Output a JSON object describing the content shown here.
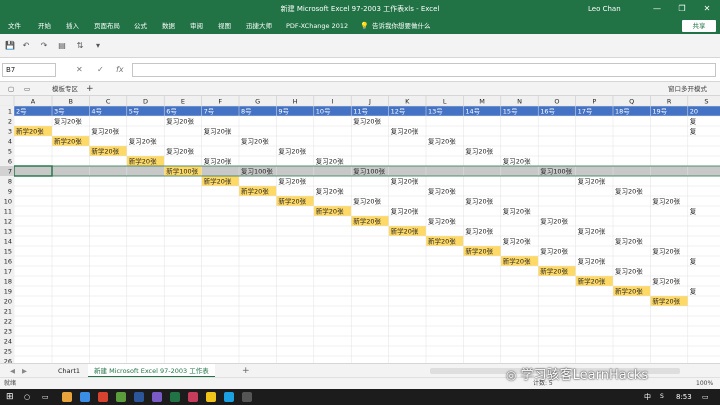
{
  "titlebar": {
    "title": "新建 Microsoft Excel 97-2003 工作表xls  -  Excel",
    "user": "Leo Chan",
    "min_glyph": "—",
    "restore_glyph": "❐",
    "close_glyph": "✕"
  },
  "ribbon": {
    "tabs": [
      "文件",
      "开始",
      "插入",
      "页面布局",
      "公式",
      "数据",
      "审阅",
      "视图",
      "迅捷大师",
      "PDF-XChange 2012"
    ],
    "tell_me": "告诉我你想要做什么",
    "share": "共享"
  },
  "formula_bar": {
    "name_box": "B7",
    "cancel_glyph": "✕",
    "enter_glyph": "✓",
    "fx": "fx",
    "value": ""
  },
  "workbook_strip": {
    "template": "模板专区",
    "add": "+",
    "window_mode": "窗口多开模式"
  },
  "colors": {
    "excel_green": "#217346",
    "day_header": "#4472c4",
    "new_fill": "#ffd966",
    "review_fill": "#ffffff",
    "selected_row": "#c8c8c8"
  },
  "grid": {
    "columns": [
      "A",
      "B",
      "C",
      "D",
      "E",
      "F",
      "G",
      "H",
      "I",
      "J",
      "K",
      "L",
      "M",
      "N",
      "O",
      "P",
      "Q",
      "R",
      "S",
      "T"
    ],
    "row_numbers": [
      "1",
      "2",
      "3",
      "4",
      "5",
      "6",
      "7",
      "8",
      "9",
      "10",
      "11",
      "12",
      "13",
      "14",
      "15",
      "16",
      "17",
      "18",
      "19",
      "20",
      "21",
      "22",
      "23",
      "24",
      "25",
      "26"
    ],
    "days": [
      "2号",
      "3号",
      "4号",
      "5号",
      "6号",
      "7号",
      "8号",
      "9号",
      "10号",
      "11号",
      "12号",
      "13号",
      "14号",
      "15号",
      "16号",
      "17号",
      "18号",
      "19号",
      "20"
    ],
    "cells": [
      {
        "r": 2,
        "c": 1,
        "t": "复习20张",
        "k": "review"
      },
      {
        "r": 2,
        "c": 4,
        "t": "复习20张",
        "k": "review"
      },
      {
        "r": 2,
        "c": 9,
        "t": "复习20张",
        "k": "review"
      },
      {
        "r": 2,
        "c": 18,
        "t": "复",
        "k": "review"
      },
      {
        "r": 3,
        "c": 0,
        "t": "新学20张",
        "k": "new"
      },
      {
        "r": 3,
        "c": 2,
        "t": "复习20张",
        "k": "review"
      },
      {
        "r": 3,
        "c": 5,
        "t": "复习20张",
        "k": "review"
      },
      {
        "r": 3,
        "c": 10,
        "t": "复习20张",
        "k": "review"
      },
      {
        "r": 3,
        "c": 18,
        "t": "复",
        "k": "review"
      },
      {
        "r": 4,
        "c": 1,
        "t": "新学20张",
        "k": "new"
      },
      {
        "r": 4,
        "c": 3,
        "t": "复习20张",
        "k": "review"
      },
      {
        "r": 4,
        "c": 6,
        "t": "复习20张",
        "k": "review"
      },
      {
        "r": 4,
        "c": 11,
        "t": "复习20张",
        "k": "review"
      },
      {
        "r": 5,
        "c": 2,
        "t": "新学20张",
        "k": "new"
      },
      {
        "r": 5,
        "c": 4,
        "t": "复习20张",
        "k": "review"
      },
      {
        "r": 5,
        "c": 7,
        "t": "复习20张",
        "k": "review"
      },
      {
        "r": 5,
        "c": 12,
        "t": "复习20张",
        "k": "review"
      },
      {
        "r": 6,
        "c": 3,
        "t": "新学20张",
        "k": "new"
      },
      {
        "r": 6,
        "c": 5,
        "t": "复习20张",
        "k": "review"
      },
      {
        "r": 6,
        "c": 8,
        "t": "复习20张",
        "k": "review"
      },
      {
        "r": 6,
        "c": 13,
        "t": "复习20张",
        "k": "review"
      },
      {
        "r": 7,
        "c": 4,
        "t": "新学100张",
        "k": "new"
      },
      {
        "r": 7,
        "c": 6,
        "t": "复习100张",
        "k": "review"
      },
      {
        "r": 7,
        "c": 9,
        "t": "复习100张",
        "k": "review"
      },
      {
        "r": 7,
        "c": 14,
        "t": "复习100张",
        "k": "review"
      },
      {
        "r": 8,
        "c": 5,
        "t": "新学20张",
        "k": "new"
      },
      {
        "r": 8,
        "c": 7,
        "t": "复习20张",
        "k": "review"
      },
      {
        "r": 8,
        "c": 10,
        "t": "复习20张",
        "k": "review"
      },
      {
        "r": 8,
        "c": 15,
        "t": "复习20张",
        "k": "review"
      },
      {
        "r": 9,
        "c": 6,
        "t": "新学20张",
        "k": "new"
      },
      {
        "r": 9,
        "c": 8,
        "t": "复习20张",
        "k": "review"
      },
      {
        "r": 9,
        "c": 11,
        "t": "复习20张",
        "k": "review"
      },
      {
        "r": 9,
        "c": 16,
        "t": "复习20张",
        "k": "review"
      },
      {
        "r": 10,
        "c": 7,
        "t": "新学20张",
        "k": "new"
      },
      {
        "r": 10,
        "c": 9,
        "t": "复习20张",
        "k": "review"
      },
      {
        "r": 10,
        "c": 12,
        "t": "复习20张",
        "k": "review"
      },
      {
        "r": 10,
        "c": 17,
        "t": "复习20张",
        "k": "review"
      },
      {
        "r": 11,
        "c": 8,
        "t": "新学20张",
        "k": "new"
      },
      {
        "r": 11,
        "c": 10,
        "t": "复习20张",
        "k": "review"
      },
      {
        "r": 11,
        "c": 13,
        "t": "复习20张",
        "k": "review"
      },
      {
        "r": 11,
        "c": 18,
        "t": "复",
        "k": "review"
      },
      {
        "r": 12,
        "c": 9,
        "t": "新学20张",
        "k": "new"
      },
      {
        "r": 12,
        "c": 11,
        "t": "复习20张",
        "k": "review"
      },
      {
        "r": 12,
        "c": 14,
        "t": "复习20张",
        "k": "review"
      },
      {
        "r": 13,
        "c": 10,
        "t": "新学20张",
        "k": "new"
      },
      {
        "r": 13,
        "c": 12,
        "t": "复习20张",
        "k": "review"
      },
      {
        "r": 13,
        "c": 15,
        "t": "复习20张",
        "k": "review"
      },
      {
        "r": 14,
        "c": 11,
        "t": "新学20张",
        "k": "new"
      },
      {
        "r": 14,
        "c": 13,
        "t": "复习20张",
        "k": "review"
      },
      {
        "r": 14,
        "c": 16,
        "t": "复习20张",
        "k": "review"
      },
      {
        "r": 15,
        "c": 12,
        "t": "新学20张",
        "k": "new"
      },
      {
        "r": 15,
        "c": 14,
        "t": "复习20张",
        "k": "review"
      },
      {
        "r": 15,
        "c": 17,
        "t": "复习20张",
        "k": "review"
      },
      {
        "r": 16,
        "c": 13,
        "t": "新学20张",
        "k": "new"
      },
      {
        "r": 16,
        "c": 15,
        "t": "复习20张",
        "k": "review"
      },
      {
        "r": 16,
        "c": 18,
        "t": "复",
        "k": "review"
      },
      {
        "r": 17,
        "c": 14,
        "t": "新学20张",
        "k": "new"
      },
      {
        "r": 17,
        "c": 16,
        "t": "复习20张",
        "k": "review"
      },
      {
        "r": 18,
        "c": 15,
        "t": "新学20张",
        "k": "new"
      },
      {
        "r": 18,
        "c": 17,
        "t": "复习20张",
        "k": "review"
      },
      {
        "r": 19,
        "c": 16,
        "t": "新学20张",
        "k": "new"
      },
      {
        "r": 19,
        "c": 18,
        "t": "复",
        "k": "review"
      },
      {
        "r": 20,
        "c": 17,
        "t": "新学20张",
        "k": "new"
      }
    ]
  },
  "sheet_tabs": {
    "tabs": [
      "Chart1",
      "新建 Microsoft Excel 97-2003 工作表"
    ],
    "active_index": 1,
    "add": "+"
  },
  "status": {
    "ready": "就绪",
    "count": "计数: 5",
    "zoom": "100%"
  },
  "watermark": "学习骇客LearnHacks",
  "taskbar": {
    "time": "8:53",
    "ime": "中"
  }
}
